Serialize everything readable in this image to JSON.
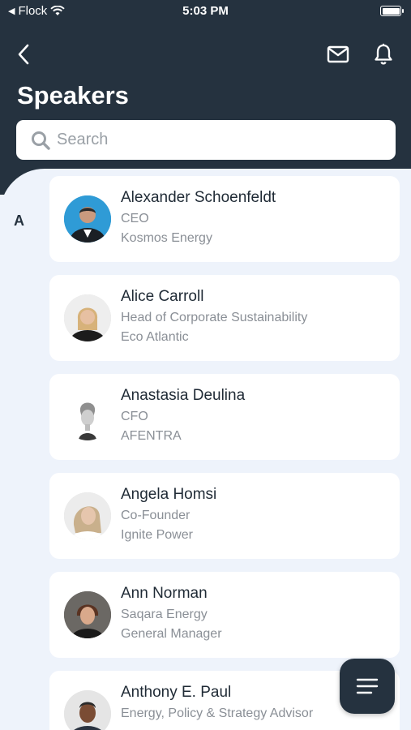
{
  "status_bar": {
    "carrier": "Flock",
    "time": "5:03 PM"
  },
  "header": {
    "title": "Speakers"
  },
  "search": {
    "placeholder": "Search",
    "value": ""
  },
  "section_letter": "A",
  "speakers": [
    {
      "name": "Alexander Schoenfeldt",
      "line1": "CEO",
      "line2": "Kosmos Energy"
    },
    {
      "name": "Alice Carroll",
      "line1": "Head of Corporate Sustainability",
      "line2": "Eco Atlantic"
    },
    {
      "name": "Anastasia Deulina",
      "line1": "CFO",
      "line2": "AFENTRA"
    },
    {
      "name": "Angela Homsi",
      "line1": "Co-Founder",
      "line2": "Ignite Power"
    },
    {
      "name": "Ann Norman",
      "line1": "Saqara Energy",
      "line2": "General Manager"
    },
    {
      "name": "Anthony E. Paul",
      "line1": "Energy, Policy & Strategy Advisor",
      "line2": ""
    }
  ],
  "colors": {
    "header_bg": "#25323f",
    "page_bg": "#eef3fb",
    "card_bg": "#ffffff"
  },
  "icons": {
    "back": "chevron-left-icon",
    "mail": "mail-icon",
    "bell": "bell-icon",
    "menu": "menu-icon",
    "search": "search-icon"
  }
}
